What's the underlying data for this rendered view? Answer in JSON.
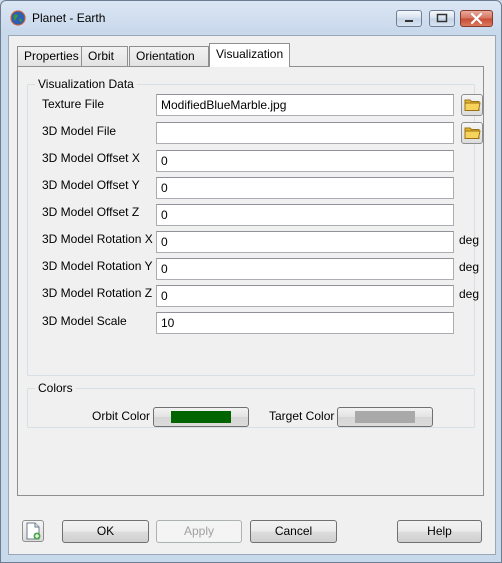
{
  "window": {
    "title": "Planet - Earth"
  },
  "tabs": [
    {
      "label": "Properties"
    },
    {
      "label": "Orbit"
    },
    {
      "label": "Orientation"
    },
    {
      "label": "Visualization",
      "active": true
    }
  ],
  "visualization": {
    "group_title": "Visualization Data",
    "fields": [
      {
        "label": "Texture File",
        "value": "ModifiedBlueMarble.jpg",
        "unit": ""
      },
      {
        "label": "3D Model File",
        "value": "",
        "unit": ""
      },
      {
        "label": "3D Model Offset X",
        "value": "0",
        "unit": ""
      },
      {
        "label": "3D Model Offset Y",
        "value": "0",
        "unit": ""
      },
      {
        "label": "3D Model Offset Z",
        "value": "0",
        "unit": ""
      },
      {
        "label": "3D Model Rotation X",
        "value": "0",
        "unit": "deg"
      },
      {
        "label": "3D Model Rotation Y",
        "value": "0",
        "unit": "deg"
      },
      {
        "label": "3D Model Rotation Z",
        "value": "0",
        "unit": "deg"
      },
      {
        "label": "3D Model Scale",
        "value": "10",
        "unit": ""
      }
    ]
  },
  "colors": {
    "group_title": "Colors",
    "orbit_label": "Orbit Color",
    "orbit_color": "#006400",
    "target_label": "Target Color",
    "target_color": "#a9a9a9"
  },
  "buttons": {
    "ok": "OK",
    "apply": "Apply",
    "cancel": "Cancel",
    "help": "Help"
  },
  "icons": {
    "app": "planet-globe-icon",
    "browse": "folder-icon",
    "new_script": "document-add-icon"
  }
}
